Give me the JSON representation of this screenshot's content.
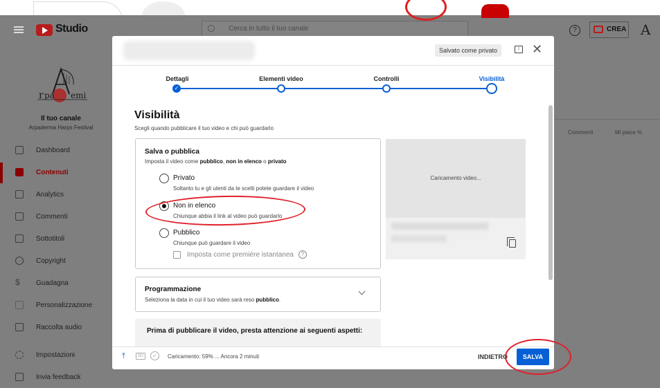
{
  "header": {
    "logo_text": "Studio",
    "search_placeholder": "Cerca in tutto il tuo canale",
    "create_label": "CREA",
    "help_glyph": "?"
  },
  "sidebar": {
    "channel_label": "Il tuo canale",
    "channel_name": "Arpaderma Harps Festival",
    "items": [
      {
        "label": "Dashboard",
        "icon": "dashboard-icon"
      },
      {
        "label": "Contenuti",
        "icon": "content-icon",
        "active": true
      },
      {
        "label": "Analytics",
        "icon": "analytics-icon"
      },
      {
        "label": "Commenti",
        "icon": "comments-icon"
      },
      {
        "label": "Sottotitoli",
        "icon": "subtitles-icon"
      },
      {
        "label": "Copyright",
        "icon": "copyright-icon"
      },
      {
        "label": "Guadagna",
        "icon": "monetization-icon"
      },
      {
        "label": "Personalizzazione",
        "icon": "customization-icon"
      },
      {
        "label": "Raccolta audio",
        "icon": "audio-library-icon"
      },
      {
        "label": "Impostazioni",
        "icon": "settings-icon"
      },
      {
        "label": "Invia feedback",
        "icon": "feedback-icon"
      }
    ]
  },
  "background_table": {
    "col_comments": "Commenti",
    "col_likes": "Mi piace %"
  },
  "dialog": {
    "saved_badge": "Salvato come privato",
    "close_glyph": "✕",
    "steps": [
      {
        "label": "Dettagli",
        "state": "done"
      },
      {
        "label": "Elementi video",
        "state": "pending"
      },
      {
        "label": "Controlli",
        "state": "pending"
      },
      {
        "label": "Visibilità",
        "state": "current"
      }
    ],
    "visibility": {
      "title": "Visibilità",
      "subtitle": "Scegli quando pubblicare il tuo video e chi può guardarlo"
    },
    "save_publish": {
      "title": "Salva o pubblica",
      "desc_pre": "Imposta il video come ",
      "desc_b1": "pubblico",
      "desc_mid1": ", ",
      "desc_b2": "non in elenco",
      "desc_mid2": " o ",
      "desc_b3": "privato",
      "options": [
        {
          "label": "Privato",
          "desc": "Soltanto tu e gli utenti da te scelti potete guardare il video",
          "selected": false
        },
        {
          "label": "Non in elenco",
          "desc": "Chiunque abbia il link al video può guardarlo",
          "selected": true
        },
        {
          "label": "Pubblico",
          "desc": "Chiunque può guardare il video",
          "selected": false
        }
      ],
      "premiere_label": "Imposta come première istantanea",
      "premiere_checked": false
    },
    "preview": {
      "loading_text": "Caricamento video..."
    },
    "schedule": {
      "title": "Programmazione",
      "desc_pre": "Seleziona la data in cui il tuo video sarà reso ",
      "desc_b": "pubblico",
      "desc_post": "."
    },
    "warning_title": "Prima di pubblicare il video, presta attenzione ai seguenti aspetti:",
    "footer": {
      "sd_badge": "SD",
      "upload_status": "Caricamento: 59% ... Ancora 2 minuti",
      "upload_progress_pct": 59,
      "back_label": "INDIETRO",
      "save_label": "SALVA"
    }
  },
  "colors": {
    "accent": "#065fd4",
    "brand_red": "#b81c1c",
    "annotation_red": "#e0202a",
    "active_nav": "#8b0000"
  }
}
